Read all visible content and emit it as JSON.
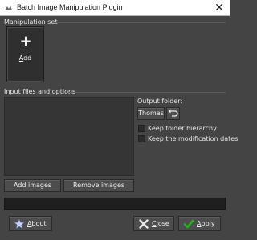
{
  "window": {
    "title": "Batch Image Manipulation Plugin",
    "close_glyph": "✕"
  },
  "manipulation_set": {
    "label": "Manipulation set",
    "add_tile": {
      "icon": "plus-icon",
      "plus_glyph": "+",
      "label_mnemonic": "A",
      "label_rest": "dd"
    }
  },
  "input_files": {
    "label": "Input files and options",
    "add_images_label": "Add images",
    "remove_images_label": "Remove images"
  },
  "output": {
    "label": "Output folder:",
    "folder_button_label": "Thomas",
    "revert_icon": "undo-arrow-icon",
    "keep_hierarchy_label": "Keep folder hierarchy",
    "keep_hierarchy_checked": false,
    "keep_dates_label": "Keep the modification dates",
    "keep_dates_checked": false
  },
  "progress": {
    "fraction": 0
  },
  "footer": {
    "about": {
      "icon": "star-icon",
      "mnemonic": "A",
      "rest": "bout"
    },
    "close": {
      "icon": "close-x-icon",
      "mnemonic": "C",
      "rest": "lose"
    },
    "apply": {
      "icon": "checkmark-icon",
      "mnemonic": "A",
      "rest": "pply"
    }
  },
  "colors": {
    "background": "#444444",
    "apply_check": "#22b422",
    "close_x": "#e8e8e8",
    "star": "#c8d2ff"
  }
}
